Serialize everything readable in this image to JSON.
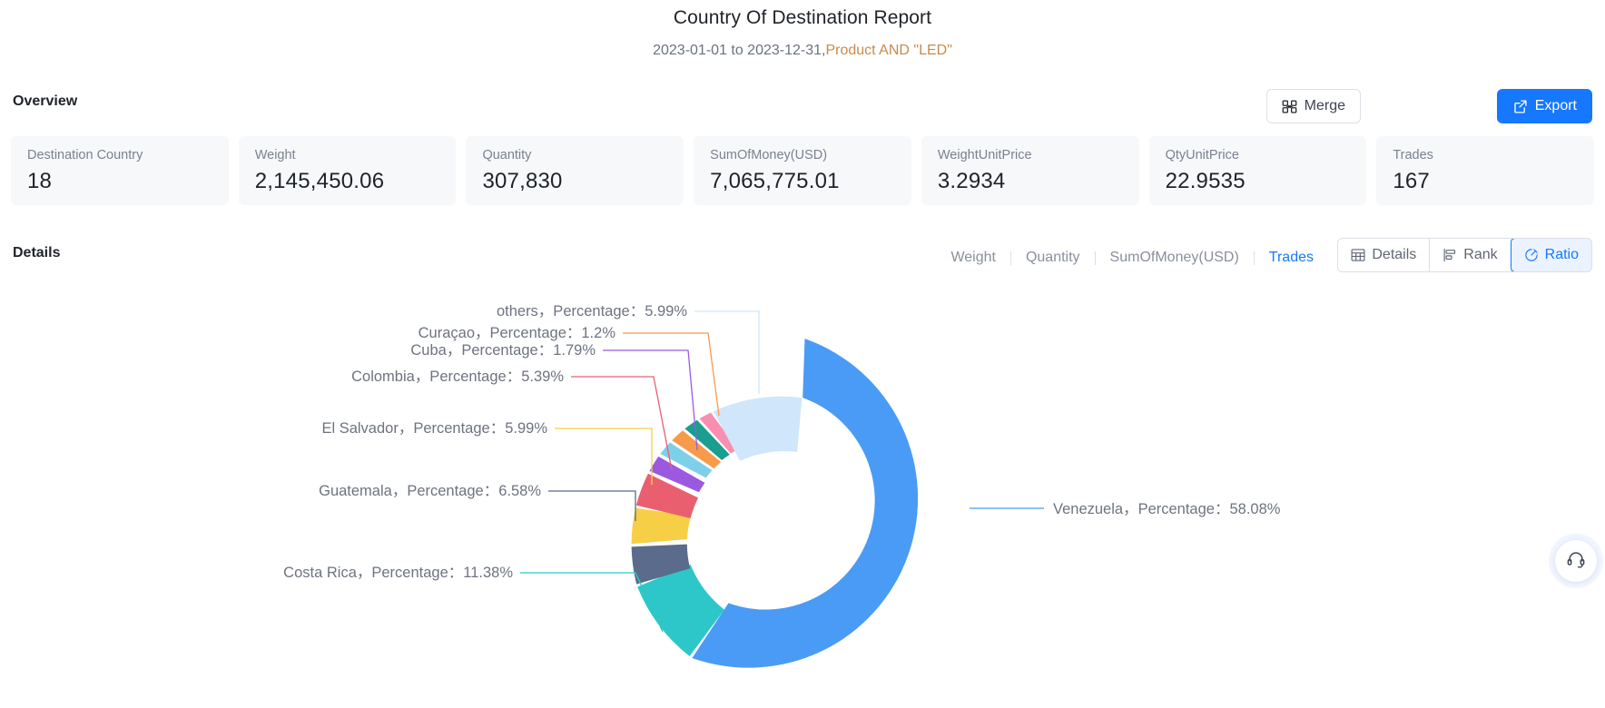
{
  "header": {
    "title": "Country Of Destination Report",
    "subtitle_date": "2023-01-01 to 2023-12-31,",
    "subtitle_filter": "Product AND \"LED\""
  },
  "toolbar": {
    "overview_label": "Overview",
    "details_label": "Details",
    "merge_label": "Merge",
    "export_label": "Export"
  },
  "overview": {
    "cards": [
      {
        "label": "Destination Country",
        "value": "18"
      },
      {
        "label": "Weight",
        "value": "2,145,450.06"
      },
      {
        "label": "Quantity",
        "value": "307,830"
      },
      {
        "label": "SumOfMoney(USD)",
        "value": "7,065,775.01"
      },
      {
        "label": "WeightUnitPrice",
        "value": "3.2934"
      },
      {
        "label": "QtyUnitPrice",
        "value": "22.9535"
      },
      {
        "label": "Trades",
        "value": "167"
      }
    ]
  },
  "details": {
    "metric_tabs": [
      {
        "label": "Weight",
        "active": false
      },
      {
        "label": "Quantity",
        "active": false
      },
      {
        "label": "SumOfMoney(USD)",
        "active": false
      },
      {
        "label": "Trades",
        "active": true
      }
    ],
    "view_modes": [
      {
        "label": "Details",
        "icon": "table-icon",
        "active": false
      },
      {
        "label": "Rank",
        "icon": "bar-chart-icon",
        "active": false
      },
      {
        "label": "Ratio",
        "icon": "pie-chart-icon",
        "active": true
      }
    ]
  },
  "support": {
    "icon": "headset-icon"
  },
  "colors": {
    "accent": "#1677ff",
    "accent_soft": "#eaf3ff",
    "card_bg": "#f7f8fa",
    "text_primary": "#1f2329",
    "text_muted": "#6e737f",
    "filter_token": "#c78b4a"
  },
  "chart_data": {
    "type": "pie",
    "variant": "donut",
    "metric": "Trades",
    "title": "",
    "label_template": "{name}，Percentage：{value}%",
    "legend": "none",
    "labels_position": "outside-with-leader-lines",
    "categories": [
      "Venezuela",
      "Costa Rica",
      "Guatemala",
      "El Salvador",
      "Colombia",
      "Cuba",
      "Curaçao",
      "others"
    ],
    "values": [
      58.08,
      11.38,
      6.58,
      5.99,
      5.39,
      1.79,
      1.2,
      5.99
    ],
    "unit": "%",
    "slice_colors": [
      "#4a9bf5",
      "#2ec7c9",
      "#5b6b8c",
      "#f7cf46",
      "#ea5f70",
      "#9b59e0",
      "#f79a4a",
      "#cfe6fb"
    ],
    "sub_slices": {
      "note": "the others group is rendered as small adjacent slices",
      "colors": [
        "#7ed0e8",
        "#1a9e8f",
        "#f98fb0"
      ]
    },
    "data_labels": [
      {
        "name": "others",
        "text": "others，Percentage：5.99%",
        "color": "#cfe6fb"
      },
      {
        "name": "Curaçao",
        "text": "Curaçao，Percentage：1.2%",
        "color": "#f79a4a"
      },
      {
        "name": "Cuba",
        "text": "Cuba，Percentage：1.79%",
        "color": "#9b59e0"
      },
      {
        "name": "Colombia",
        "text": "Colombia，Percentage：5.39%",
        "color": "#ea5f70"
      },
      {
        "name": "El Salvador",
        "text": "El Salvador，Percentage：5.99%",
        "color": "#f7cf46"
      },
      {
        "name": "Guatemala",
        "text": "Guatemala，Percentage：6.58%",
        "color": "#5b6b8c"
      },
      {
        "name": "Costa Rica",
        "text": "Costa Rica，Percentage：11.38%",
        "color": "#2ec7c9"
      },
      {
        "name": "Venezuela",
        "text": "Venezuela，Percentage：58.08%",
        "color": "#4a9bf5"
      }
    ]
  }
}
